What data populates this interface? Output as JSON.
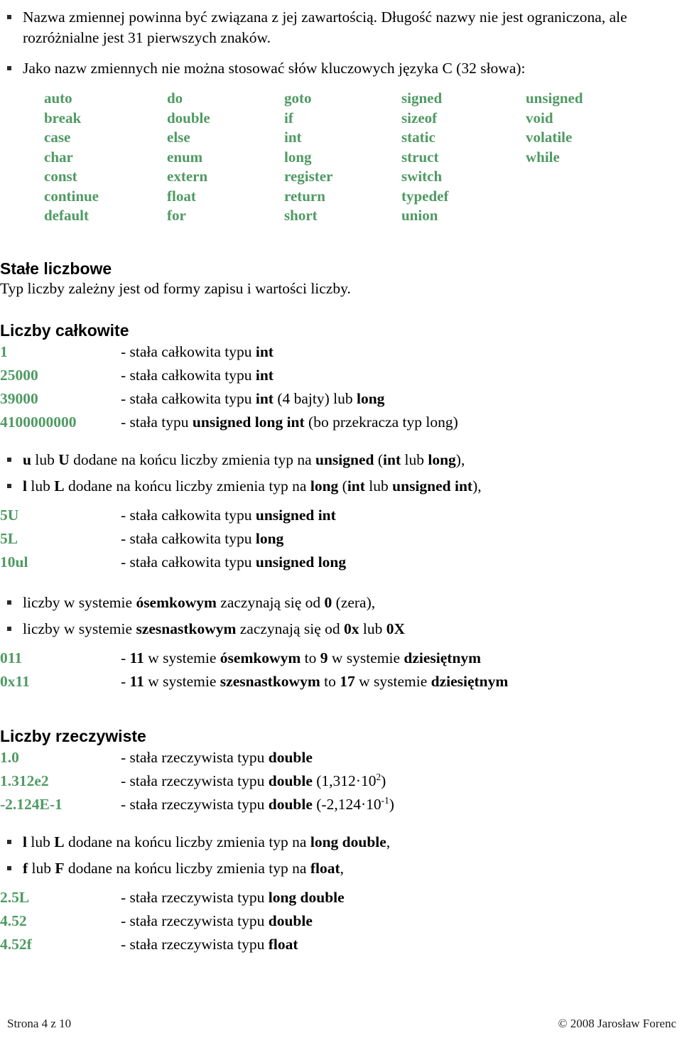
{
  "intro_bullets": [
    "Nazwa zmiennej powinna być związana z jej zawartością. Długość nazwy nie jest ograniczona, ale rozróżnialne jest 31 pierwszych znaków.",
    "Jako nazw zmiennych nie można stosować słów kluczowych języka C (32 słowa):"
  ],
  "keywords": {
    "columns": [
      [
        "auto",
        "break",
        "case",
        "char",
        "const",
        "continue",
        "default"
      ],
      [
        "do",
        "double",
        "else",
        "enum",
        "extern",
        "float",
        "for"
      ],
      [
        "goto",
        "if",
        "int",
        "long",
        "register",
        "return",
        "short"
      ],
      [
        "signed",
        "sizeof",
        "static",
        "struct",
        "switch",
        "typedef",
        "union"
      ],
      [
        "unsigned",
        "void",
        "volatile",
        "while",
        "",
        "",
        ""
      ]
    ]
  },
  "sections": {
    "constants": {
      "heading": "Stałe liczbowe",
      "paragraph": "Typ liczby zależny jest od formy zapisu i wartości liczby."
    },
    "integers": {
      "heading": "Liczby całkowite",
      "rows": [
        {
          "value": "1",
          "desc_parts": [
            {
              "t": "- stała całkowita typu ",
              "b": false
            },
            {
              "t": "int",
              "b": true
            }
          ]
        },
        {
          "value": "25000",
          "desc_parts": [
            {
              "t": "- stała całkowita typu ",
              "b": false
            },
            {
              "t": "int",
              "b": true
            }
          ]
        },
        {
          "value": "39000",
          "desc_parts": [
            {
              "t": "- stała całkowita typu ",
              "b": false
            },
            {
              "t": "int",
              "b": true
            },
            {
              "t": " (4 bajty) lub ",
              "b": false
            },
            {
              "t": "long",
              "b": true
            }
          ]
        },
        {
          "value": "4100000000",
          "desc_parts": [
            {
              "t": "- stała typu ",
              "b": false
            },
            {
              "t": "unsigned long int",
              "b": true
            },
            {
              "t": " (bo przekracza typ long)",
              "b": false
            }
          ]
        }
      ],
      "suffix_bullets": [
        [
          {
            "t": "u",
            "b": true
          },
          {
            "t": " lub ",
            "b": false
          },
          {
            "t": "U",
            "b": true
          },
          {
            "t": " dodane na końcu liczby zmienia typ na ",
            "b": false
          },
          {
            "t": "unsigned",
            "b": true
          },
          {
            "t": " (",
            "b": false
          },
          {
            "t": "int",
            "b": true
          },
          {
            "t": " lub ",
            "b": false
          },
          {
            "t": "long",
            "b": true
          },
          {
            "t": "),",
            "b": false
          }
        ],
        [
          {
            "t": "l",
            "b": true
          },
          {
            "t": " lub ",
            "b": false
          },
          {
            "t": "L",
            "b": true
          },
          {
            "t": " dodane na końcu liczby zmienia typ na ",
            "b": false
          },
          {
            "t": "long",
            "b": true
          },
          {
            "t": " (",
            "b": false
          },
          {
            "t": "int",
            "b": true
          },
          {
            "t": " lub ",
            "b": false
          },
          {
            "t": "unsigned int",
            "b": true
          },
          {
            "t": "),",
            "b": false
          }
        ]
      ],
      "suffix_rows": [
        {
          "value": "5U",
          "desc_parts": [
            {
              "t": "- stała całkowita typu ",
              "b": false
            },
            {
              "t": "unsigned int",
              "b": true
            }
          ]
        },
        {
          "value": "5L",
          "desc_parts": [
            {
              "t": "- stała całkowita typu ",
              "b": false
            },
            {
              "t": "long",
              "b": true
            }
          ]
        },
        {
          "value": "10ul",
          "desc_parts": [
            {
              "t": "- stała całkowita typu ",
              "b": false
            },
            {
              "t": "unsigned long",
              "b": true
            }
          ]
        }
      ],
      "base_bullets": [
        [
          {
            "t": "liczby w systemie ",
            "b": false
          },
          {
            "t": "ósemkowym",
            "b": true
          },
          {
            "t": " zaczynają się od ",
            "b": false
          },
          {
            "t": "0",
            "b": true
          },
          {
            "t": " (zera),",
            "b": false
          }
        ],
        [
          {
            "t": "liczby w systemie ",
            "b": false
          },
          {
            "t": "szesnastkowym",
            "b": true
          },
          {
            "t": " zaczynają się od ",
            "b": false
          },
          {
            "t": "0x",
            "b": true
          },
          {
            "t": " lub ",
            "b": false
          },
          {
            "t": "0X",
            "b": true
          }
        ]
      ],
      "base_rows": [
        {
          "value": "011",
          "desc_parts": [
            {
              "t": "- ",
              "b": false
            },
            {
              "t": "11",
              "b": true
            },
            {
              "t": " w systemie ",
              "b": false
            },
            {
              "t": "ósemkowym",
              "b": true
            },
            {
              "t": " to ",
              "b": false
            },
            {
              "t": "9",
              "b": true
            },
            {
              "t": " w systemie ",
              "b": false
            },
            {
              "t": "dziesiętnym",
              "b": true
            }
          ]
        },
        {
          "value": "0x11",
          "desc_parts": [
            {
              "t": "- ",
              "b": false
            },
            {
              "t": "11",
              "b": true
            },
            {
              "t": " w systemie ",
              "b": false
            },
            {
              "t": "szesnastkowym",
              "b": true
            },
            {
              "t": " to ",
              "b": false
            },
            {
              "t": "17",
              "b": true
            },
            {
              "t": " w systemie ",
              "b": false
            },
            {
              "t": "dziesiętnym",
              "b": true
            }
          ]
        }
      ]
    },
    "reals": {
      "heading": "Liczby rzeczywiste",
      "rows": [
        {
          "value": "1.0",
          "desc_parts": [
            {
              "t": "- stała rzeczywista typu ",
              "b": false
            },
            {
              "t": "double",
              "b": true
            }
          ]
        },
        {
          "value": "1.312e2",
          "desc_parts": [
            {
              "t": "- stała rzeczywista typu ",
              "b": false
            },
            {
              "t": "double",
              "b": true
            },
            {
              "t": " (1,312·10",
              "b": false
            },
            {
              "t": "2",
              "b": false,
              "sup": true
            },
            {
              "t": ")",
              "b": false
            }
          ]
        },
        {
          "value": "-2.124E-1",
          "desc_parts": [
            {
              "t": "- stała rzeczywista typu ",
              "b": false
            },
            {
              "t": "double",
              "b": true
            },
            {
              "t": " (-2,124·10",
              "b": false
            },
            {
              "t": "-1",
              "b": false,
              "sup": true
            },
            {
              "t": ")",
              "b": false
            }
          ]
        }
      ],
      "suffix_bullets": [
        [
          {
            "t": "l",
            "b": true
          },
          {
            "t": " lub ",
            "b": false
          },
          {
            "t": "L",
            "b": true
          },
          {
            "t": " dodane na końcu liczby zmienia typ na ",
            "b": false
          },
          {
            "t": "long double",
            "b": true
          },
          {
            "t": ",",
            "b": false
          }
        ],
        [
          {
            "t": "f",
            "b": true
          },
          {
            "t": " lub ",
            "b": false
          },
          {
            "t": "F",
            "b": true
          },
          {
            "t": " dodane na końcu liczby zmienia typ na ",
            "b": false
          },
          {
            "t": "float",
            "b": true
          },
          {
            "t": ",",
            "b": false
          }
        ]
      ],
      "suffix_rows": [
        {
          "value": "2.5L",
          "desc_parts": [
            {
              "t": "- stała rzeczywista typu ",
              "b": false
            },
            {
              "t": "long double",
              "b": true
            }
          ]
        },
        {
          "value": "4.52",
          "desc_parts": [
            {
              "t": "- stała rzeczywista typu ",
              "b": false
            },
            {
              "t": "double",
              "b": true
            }
          ]
        },
        {
          "value": "4.52f",
          "desc_parts": [
            {
              "t": "- stała rzeczywista typu ",
              "b": false
            },
            {
              "t": "float",
              "b": true
            }
          ]
        }
      ]
    }
  },
  "footer": {
    "page_label": "Strona 4 z 10",
    "copyright": "© 2008 Jarosław Forenc"
  },
  "colors": {
    "keyword_green": "#4f9a63",
    "text_black": "#000000"
  }
}
